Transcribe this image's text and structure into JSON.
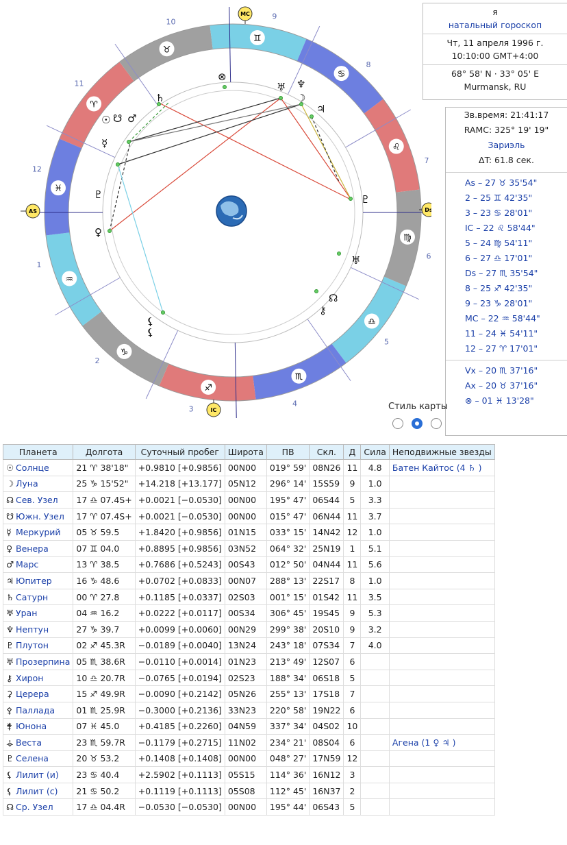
{
  "chart": {
    "mc_label": "MC",
    "ic_label": "IC",
    "as_label": "AS",
    "ds_label": "Ds",
    "houses": [
      "1",
      "2",
      "3",
      "4",
      "5",
      "6",
      "7",
      "8",
      "9",
      "10",
      "11",
      "12"
    ],
    "signs_ring": [
      "♈",
      "♉",
      "♊",
      "♋",
      "♌",
      "♍",
      "♎",
      "♏",
      "♐",
      "♑",
      "♒",
      "♓"
    ],
    "planet_glyphs": [
      "☉",
      "☊",
      "♂",
      "♄",
      "♅",
      "♆",
      "☽",
      "♃",
      "☿",
      "♇",
      "♀",
      "♇",
      "♅",
      "☋",
      "⚷",
      "⊗"
    ],
    "ring_colors": [
      "#e07a7a",
      "#a0a0a0",
      "#7ad0e6",
      "#6d7fe0"
    ]
  },
  "natal": {
    "name": "я",
    "type": "натальный гороскоп",
    "date": "Чт, 11 апреля 1996 г.",
    "time": "10:10:00 GMT+4:00",
    "coords": "68° 58' N · 33° 05' E",
    "place": "Murmansk, RU"
  },
  "time_info": {
    "sidereal": "Зв.время: 21:41:17",
    "ramc": "RAMC: 325° 19' 19\"",
    "system": "Зариэль",
    "delta": "ΔT: 61.8 сек."
  },
  "cusps": [
    "As  –  27 ♉ 35'54\"",
    "2  –  25 ♊ 42'35\"",
    "3  –  23 ♋ 28'01\"",
    "IC  –  22 ♌ 58'44\"",
    "5  –  24 ♍ 54'11\"",
    "6  –  27 ♎ 17'01\"",
    "Ds  –  27 ♏ 35'54\"",
    "8  –  25 ♐ 42'35\"",
    "9  –  23 ♑ 28'01\"",
    "MC  –  22 ♒ 58'44\"",
    "11  –  24 ♓ 54'11\"",
    "12  –  27 ♈ 17'01\""
  ],
  "axes": [
    "Vx  –  20 ♏ 37'16\"",
    "Ax  –  20 ♉ 37'16\"",
    "⊗  –  01 ♓ 13'28\""
  ],
  "style_label": "Стиль карты",
  "table": {
    "headers": [
      "Планета",
      "Долгота",
      "Суточный пробег",
      "Широта",
      "ПВ",
      "Скл.",
      "Д",
      "Сила",
      "Неподвижные звезды"
    ],
    "rows": [
      [
        "☉",
        "Солнце",
        "21 ♈ 38'18\"",
        "+0.9810 [+0.9856]",
        "00N00",
        "019° 59'",
        "08N26",
        "11",
        "4.8",
        "Батен Кайтос (4 ♄ )"
      ],
      [
        "☽",
        "Луна",
        "25 ♑ 15'52\"",
        "+14.218 [+13.177]",
        "05N12",
        "296° 14'",
        "15S59",
        "9",
        "1.0",
        ""
      ],
      [
        "☊",
        "Сев. Узел",
        "17 ♎ 07.4S+",
        "+0.0021 [−0.0530]",
        "00N00",
        "195° 47'",
        "06S44",
        "5",
        "3.3",
        ""
      ],
      [
        "☋",
        "Южн. Узел",
        "17 ♈ 07.4S+",
        "+0.0021 [−0.0530]",
        "00N00",
        "015° 47'",
        "06N44",
        "11",
        "3.7",
        ""
      ],
      [
        "☿",
        "Меркурий",
        "05 ♉ 59.5",
        "+1.8420 [+0.9856]",
        "01N15",
        "033° 15'",
        "14N42",
        "12",
        "1.0",
        ""
      ],
      [
        "♀",
        "Венера",
        "07 ♊ 04.0",
        "+0.8895 [+0.9856]",
        "03N52",
        "064° 32'",
        "25N19",
        "1",
        "5.1",
        ""
      ],
      [
        "♂",
        "Марс",
        "13 ♈ 38.5",
        "+0.7686 [+0.5243]",
        "00S43",
        "012° 50'",
        "04N44",
        "11",
        "5.6",
        ""
      ],
      [
        "♃",
        "Юпитер",
        "16 ♑ 48.6",
        "+0.0702 [+0.0833]",
        "00N07",
        "288° 13'",
        "22S17",
        "8",
        "1.0",
        ""
      ],
      [
        "♄",
        "Сатурн",
        "00 ♈ 27.8",
        "+0.1185 [+0.0337]",
        "02S03",
        "001° 15'",
        "01S42",
        "11",
        "3.5",
        ""
      ],
      [
        "♅",
        "Уран",
        "04 ♒ 16.2",
        "+0.0222 [+0.0117]",
        "00S34",
        "306° 45'",
        "19S45",
        "9",
        "5.3",
        ""
      ],
      [
        "♆",
        "Нептун",
        "27 ♑ 39.7",
        "+0.0099 [+0.0060]",
        "00N29",
        "299° 38'",
        "20S10",
        "9",
        "3.2",
        ""
      ],
      [
        "♇",
        "Плутон",
        "02 ♐ 45.3R",
        "−0.0189 [+0.0040]",
        "13N24",
        "243° 18'",
        "07S34",
        "7",
        "4.0",
        ""
      ],
      [
        "♅",
        "Прозерпина",
        "05 ♏ 38.6R",
        "−0.0110 [+0.0014]",
        "01N23",
        "213° 49'",
        "12S07",
        "6",
        "",
        ""
      ],
      [
        "⚷",
        "Хирон",
        "10 ♎ 20.7R",
        "−0.0765 [+0.0194]",
        "02S23",
        "188° 34'",
        "06S18",
        "5",
        "",
        ""
      ],
      [
        "⚳",
        "Церера",
        "15 ♐ 49.9R",
        "−0.0090 [+0.2142]",
        "05N26",
        "255° 13'",
        "17S18",
        "7",
        "",
        ""
      ],
      [
        "⚴",
        "Паллада",
        "01 ♏ 25.9R",
        "−0.3000 [+0.2136]",
        "33N23",
        "220° 58'",
        "19N22",
        "6",
        "",
        ""
      ],
      [
        "⚵",
        "Юнона",
        "07 ♓ 45.0",
        "+0.4185 [+0.2260]",
        "04N59",
        "337° 34'",
        "04S02",
        "10",
        "",
        ""
      ],
      [
        "⚶",
        "Веста",
        "23 ♏ 59.7R",
        "−0.1179 [+0.2715]",
        "11N02",
        "234° 21'",
        "08S04",
        "6",
        "",
        "Агена (1 ♀ ♃ )"
      ],
      [
        "♇",
        "Селена",
        "20 ♉ 53.2",
        "+0.1408 [+0.1408]",
        "00N00",
        "048° 27'",
        "17N59",
        "12",
        "",
        ""
      ],
      [
        "⚸",
        "Лилит (и)",
        "23 ♋ 40.4",
        "+2.5902 [+0.1113]",
        "05S15",
        "114° 36'",
        "16N12",
        "3",
        "",
        ""
      ],
      [
        "⚸",
        "Лилит (с)",
        "21 ♋ 50.2",
        "+0.1119 [+0.1113]",
        "05S08",
        "112° 45'",
        "16N37",
        "2",
        "",
        ""
      ],
      [
        "☊",
        "Ср. Узел",
        "17 ♎ 04.4R",
        "−0.0530 [−0.0530]",
        "00N00",
        "195° 44'",
        "06S43",
        "5",
        "",
        ""
      ]
    ]
  }
}
